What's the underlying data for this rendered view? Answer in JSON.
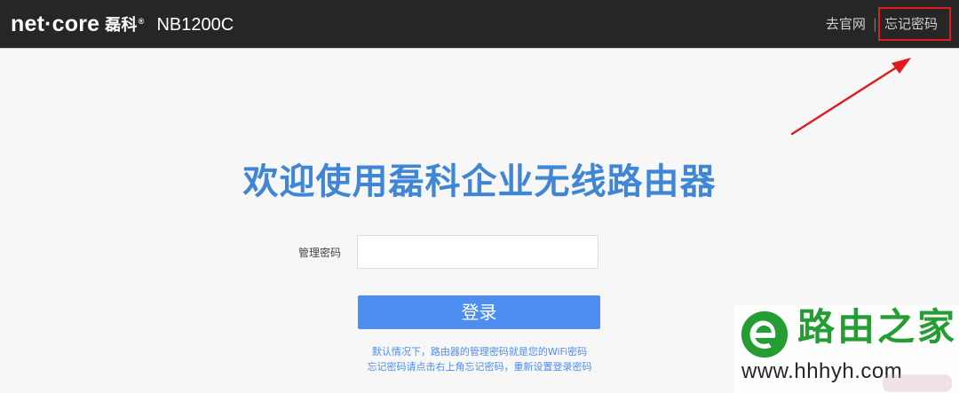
{
  "header": {
    "logo_text": "net·core",
    "logo_cn": "磊科",
    "logo_mark": "®",
    "model": "NB1200C",
    "links": {
      "official_site": "去官网",
      "separator": "|",
      "forgot_password": "忘记密码"
    }
  },
  "main": {
    "welcome_title": "欢迎使用磊科企业无线路由器",
    "login": {
      "password_label": "管理密码",
      "password_value": "",
      "login_button": "登录",
      "help_line_1": "默认情况下，路由器的管理密码就是您的WiFi密码",
      "help_line_2": "忘记密码请点击右上角忘记密码，重新设置登录密码"
    }
  },
  "annotation": {
    "highlight_color": "#e11b1b"
  },
  "watermark": {
    "name": "路由之家",
    "url": "www.hhhyh.com",
    "logo_icon": "green-e-logo-icon"
  },
  "colors": {
    "header_bg": "#262626",
    "title_blue": "#3f86d6",
    "button_blue": "#4d8ff0",
    "watermark_green": "#1e9b2c"
  }
}
